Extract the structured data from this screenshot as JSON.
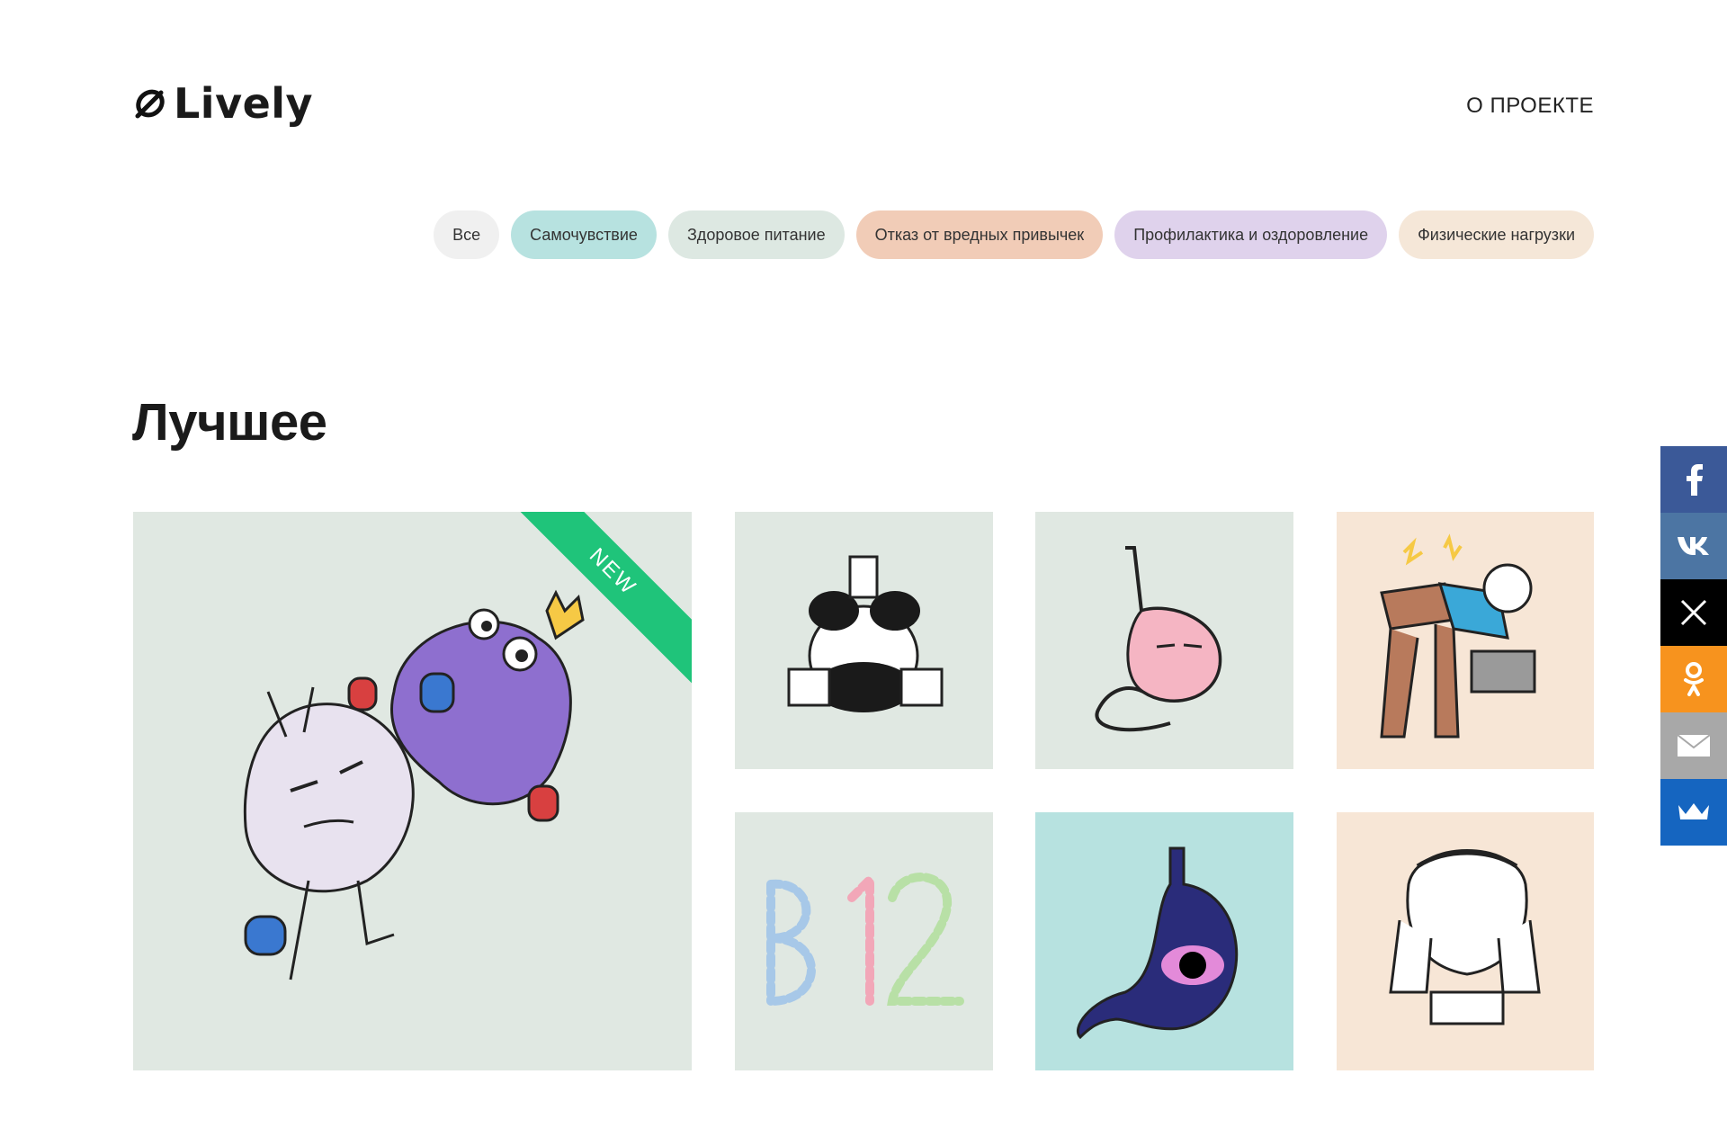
{
  "header": {
    "logo_text": "Lively",
    "nav_about": "О ПРОЕКТЕ"
  },
  "filters": [
    {
      "label": "Все",
      "color": "#f0f0f0"
    },
    {
      "label": "Самочувствие",
      "color": "#b7e2e0"
    },
    {
      "label": "Здоровое питание",
      "color": "#dde8e2"
    },
    {
      "label": "Отказ от вредных привычек",
      "color": "#f1ccb7"
    },
    {
      "label": "Профилактика и оздоровление",
      "color": "#dfd2ec"
    },
    {
      "label": "Физические нагрузки",
      "color": "#f5e7d8"
    }
  ],
  "section": {
    "title": "Лучшее"
  },
  "cards": {
    "big": {
      "badge": "NEW",
      "bg": "#e0e8e2",
      "badge_color": "#1fc47a",
      "art": "onion-and-monster-boxing-illustration"
    },
    "items": [
      {
        "bg": "#e0e8e2",
        "art": "panda-drinking-milk-illustration"
      },
      {
        "bg": "#e0e8e2",
        "art": "stomach-illustration"
      },
      {
        "bg": "#f7e6d6",
        "art": "old-man-back-pain-laptop-illustration"
      },
      {
        "bg": "#e0e8e2",
        "art": "b12-pills-illustration"
      },
      {
        "bg": "#b7e2e0",
        "art": "stomach-black-hole-illustration"
      },
      {
        "bg": "#f7e6d6",
        "art": "statue-face-palm-illustration"
      }
    ]
  },
  "social": [
    {
      "name": "facebook",
      "glyph": "f",
      "color": "#3b5998"
    },
    {
      "name": "vk",
      "glyph": "vk",
      "color": "#4c75a3"
    },
    {
      "name": "x",
      "glyph": "X",
      "color": "#000000"
    },
    {
      "name": "odnoklassniki",
      "glyph": "ok",
      "color": "#f7931e"
    },
    {
      "name": "email",
      "glyph": "mail",
      "color": "#a8a8a8"
    },
    {
      "name": "vk-crown",
      "glyph": "crown",
      "color": "#1565c0"
    }
  ]
}
